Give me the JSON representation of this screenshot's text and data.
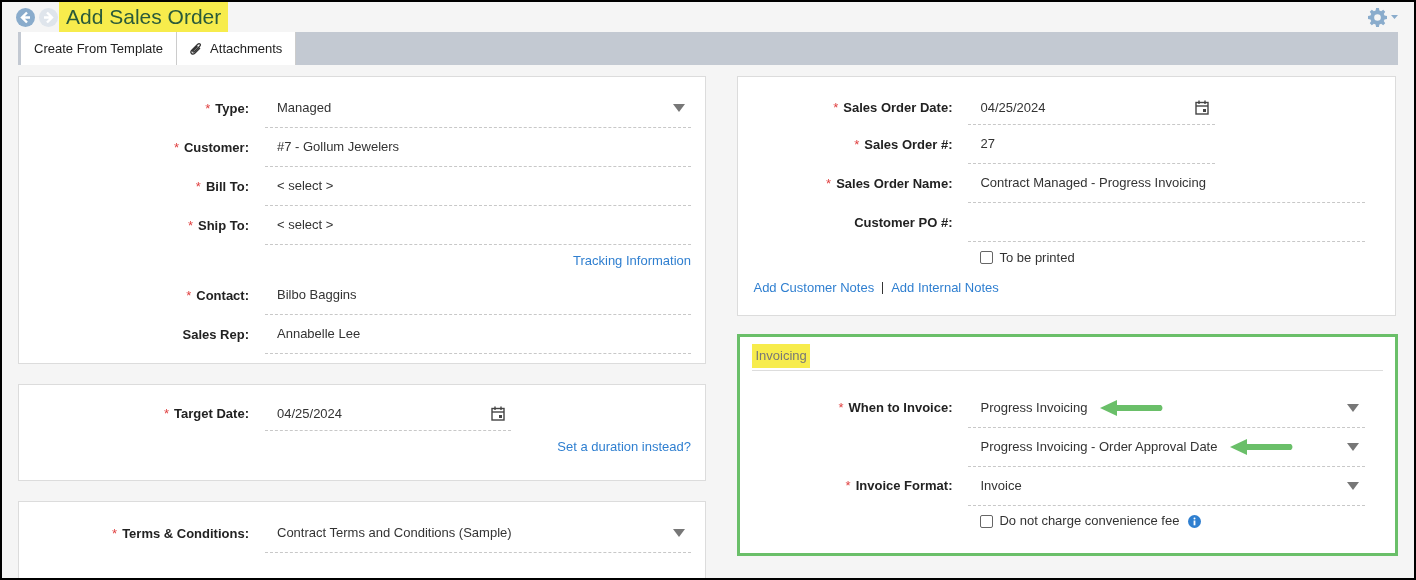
{
  "header": {
    "title": "Add Sales Order",
    "title_highlighted": true,
    "back_disabled": false,
    "forward_disabled": true
  },
  "toolbar": [
    {
      "label": "Create From Template",
      "kind": "plain"
    },
    {
      "label": "Attachments",
      "kind": "attachment"
    }
  ],
  "customer_card": [
    {
      "kind": "select",
      "required_mark": "*",
      "label": "Type:",
      "value": "Managed"
    },
    {
      "kind": "text",
      "required_mark": "*",
      "label": "Customer:",
      "value": "#7 - Gollum Jewelers"
    },
    {
      "kind": "text",
      "required_mark": "*",
      "label": "Bill To:",
      "value": "< select >"
    },
    {
      "kind": "text",
      "required_mark": "*",
      "label": "Ship To:",
      "value": "< select >"
    },
    {
      "kind": "link",
      "label": "Tracking Information"
    },
    {
      "kind": "text",
      "required_mark": "*",
      "label": "Contact:",
      "value": "Bilbo Baggins"
    },
    {
      "kind": "text",
      "label": "Sales Rep:",
      "value": "Annabelle Lee"
    }
  ],
  "target_card": [
    {
      "kind": "date",
      "required_mark": "*",
      "label": "Target Date:",
      "value": "04/25/2024"
    },
    {
      "kind": "link",
      "label": "Set a duration instead?"
    }
  ],
  "terms_card": [
    {
      "kind": "select",
      "required_mark": "*",
      "label": "Terms & Conditions:",
      "value": "Contract Terms and Conditions (Sample)"
    }
  ],
  "order_card": [
    {
      "kind": "date",
      "required_mark": "*",
      "label": "Sales Order Date:",
      "value": "04/25/2024"
    },
    {
      "kind": "short",
      "required_mark": "*",
      "label": "Sales Order #:",
      "value": "27"
    },
    {
      "kind": "text",
      "required_mark": "*",
      "label": "Sales Order Name:",
      "value": "Contract Managed - Progress Invoicing"
    },
    {
      "kind": "text",
      "label": "Customer PO #:"
    },
    {
      "kind": "checkbox",
      "label": "To be printed",
      "checked": false
    }
  ],
  "order_links": [
    "Add Customer Notes",
    "Add Internal Notes"
  ],
  "invoicing": {
    "title": "Invoicing",
    "title_highlighted": true,
    "outlined": true,
    "fields": [
      {
        "kind": "select",
        "required_mark": "*",
        "label": "When to Invoice:",
        "value": "Progress Invoicing",
        "arrow": true
      },
      {
        "kind": "select",
        "value": "Progress Invoicing - Order Approval Date",
        "arrow": true
      },
      {
        "kind": "select",
        "required_mark": "*",
        "label": "Invoice Format:",
        "value": "Invoice",
        "arrow": false
      },
      {
        "kind": "checkbox",
        "label": "Do not charge convenience fee",
        "checked": false,
        "info": true
      }
    ]
  }
}
